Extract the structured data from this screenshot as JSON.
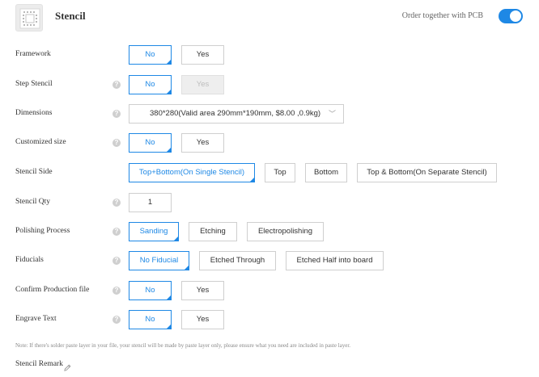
{
  "header": {
    "title": "Stencil",
    "order_together_label": "Order together with PCB",
    "order_together_on": true,
    "icon": "stencil-icon"
  },
  "rows": {
    "framework": {
      "label": "Framework",
      "options": [
        "No",
        "Yes"
      ],
      "selected": "No"
    },
    "step_stencil": {
      "label": "Step Stencil",
      "options": [
        "No",
        "Yes"
      ],
      "selected": "No",
      "disabled": [
        "Yes"
      ]
    },
    "dimensions": {
      "label": "Dimensions",
      "value": "380*280(Valid area 290mm*190mm, $8.00 ,0.9kg)"
    },
    "customized_size": {
      "label": "Customized size",
      "options": [
        "No",
        "Yes"
      ],
      "selected": "No"
    },
    "stencil_side": {
      "label": "Stencil Side",
      "options": [
        "Top+Bottom(On Single Stencil)",
        "Top",
        "Bottom",
        "Top & Bottom(On Separate Stencil)"
      ],
      "selected": "Top+Bottom(On Single Stencil)"
    },
    "stencil_qty": {
      "label": "Stencil Qty",
      "value": "1"
    },
    "polishing_process": {
      "label": "Polishing Process",
      "options": [
        "Sanding",
        "Etching",
        "Electropolishing"
      ],
      "selected": "Sanding"
    },
    "fiducials": {
      "label": "Fiducials",
      "options": [
        "No Fiducial",
        "Etched Through",
        "Etched Half into board"
      ],
      "selected": "No Fiducial"
    },
    "confirm_production_file": {
      "label": "Confirm Production file",
      "options": [
        "No",
        "Yes"
      ],
      "selected": "No"
    },
    "engrave_text": {
      "label": "Engrave Text",
      "options": [
        "No",
        "Yes"
      ],
      "selected": "No"
    }
  },
  "note": "Note:   If there's solder paste layer in your file, your stencil will be made by paste layer only, please ensure what you need are included in paste layer.",
  "remark_label": "Stencil Remark",
  "help_glyph": "?",
  "chevron_glyph": "﹀",
  "colors": {
    "accent": "#1e88e5",
    "border": "#cfcfcf",
    "disabled_bg": "#eeeeee"
  }
}
